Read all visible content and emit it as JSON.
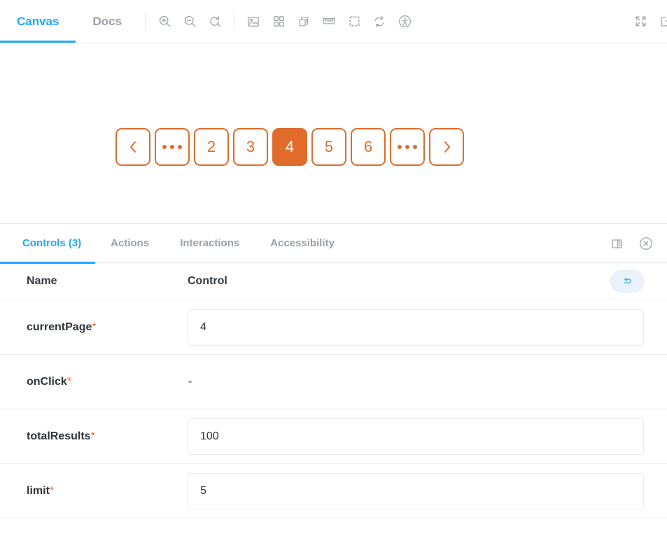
{
  "toolbar": {
    "tabs": [
      {
        "label": "Canvas",
        "active": true
      },
      {
        "label": "Docs",
        "active": false
      }
    ],
    "icons": [
      {
        "name": "zoom-in-icon"
      },
      {
        "name": "zoom-out-icon"
      },
      {
        "name": "zoom-reset-icon"
      },
      {
        "name": "background-image-icon"
      },
      {
        "name": "grid-icon"
      },
      {
        "name": "viewport-icon"
      },
      {
        "name": "measure-ruler-icon"
      },
      {
        "name": "outline-icon"
      },
      {
        "name": "remount-refresh-icon"
      },
      {
        "name": "accessibility-icon"
      },
      {
        "name": "fullscreen-expand-icon"
      },
      {
        "name": "open-in-new-tab-icon"
      }
    ],
    "active_underline_color": "#1ea7fd"
  },
  "preview": {
    "component": "pagination",
    "accent_color": "#e06b2b",
    "buttons": [
      {
        "label": "‹",
        "type": "prev",
        "name": "previous-page-button",
        "active": false
      },
      {
        "label": "…",
        "type": "dots",
        "name": "page-ellipsis-start",
        "active": false
      },
      {
        "label": "2",
        "type": "page",
        "name": "page-button-2",
        "active": false
      },
      {
        "label": "3",
        "type": "page",
        "name": "page-button-3",
        "active": false
      },
      {
        "label": "4",
        "type": "page",
        "name": "page-button-4",
        "active": true
      },
      {
        "label": "5",
        "type": "page",
        "name": "page-button-5",
        "active": false
      },
      {
        "label": "6",
        "type": "page",
        "name": "page-button-6",
        "active": false
      },
      {
        "label": "…",
        "type": "dots",
        "name": "page-ellipsis-end",
        "active": false
      },
      {
        "label": "›",
        "type": "next",
        "name": "next-page-button",
        "active": false
      }
    ]
  },
  "panel": {
    "tabs": [
      {
        "label": "Controls (3)",
        "active": true
      },
      {
        "label": "Actions",
        "active": false
      },
      {
        "label": "Interactions",
        "active": false
      },
      {
        "label": "Accessibility",
        "active": false
      }
    ],
    "tools": [
      {
        "name": "panel-position-icon"
      },
      {
        "name": "close-panel-icon"
      }
    ],
    "table": {
      "columns": {
        "name": "Name",
        "control": "Control"
      },
      "reset_label": "Reset controls",
      "rows": [
        {
          "name": "currentPage",
          "required": "*",
          "kind": "input",
          "value": "4"
        },
        {
          "name": "onClick",
          "required": "*",
          "kind": "text",
          "value": "-"
        },
        {
          "name": "totalResults",
          "required": "*",
          "kind": "input",
          "value": "100"
        },
        {
          "name": "limit",
          "required": "*",
          "kind": "input",
          "value": "5"
        }
      ]
    }
  }
}
